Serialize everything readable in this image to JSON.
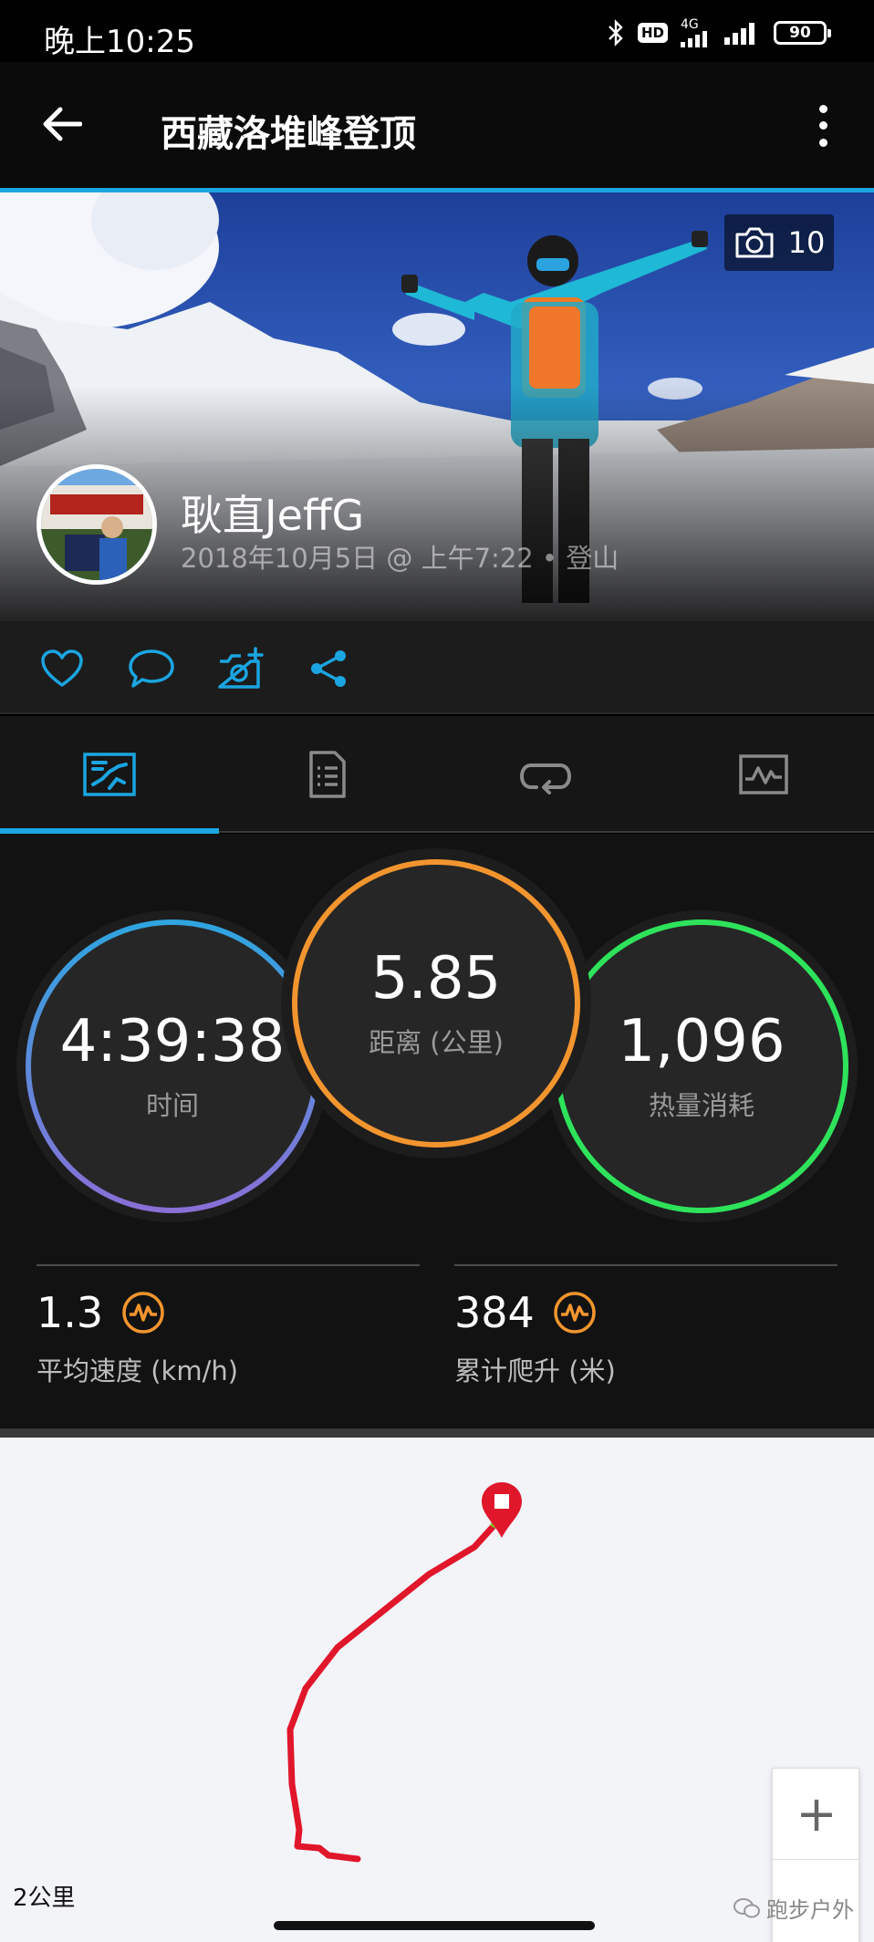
{
  "status_bar": {
    "time": "晚上10:25",
    "hd": "HD",
    "network": "4G",
    "battery": "90",
    "icons": [
      "bluetooth-icon",
      "hd-voice-icon",
      "signal-4g-icon",
      "signal-icon",
      "battery-icon"
    ]
  },
  "header": {
    "title": "西藏洛堆峰登顶",
    "back_icon": "arrow-left-icon",
    "menu_icon": "more-vertical-icon"
  },
  "hero": {
    "photo_count": "10",
    "photo_icon": "camera-icon",
    "user_name": "耿直JeffG",
    "activity_meta": "2018年10月5日 @ 上午7:22 • 登山"
  },
  "actions": [
    "like-icon",
    "comment-icon",
    "add-photo-icon",
    "share-icon"
  ],
  "tabs": [
    "overview-tab-icon",
    "details-tab-icon",
    "laps-tab-icon",
    "charts-tab-icon"
  ],
  "stats": {
    "time": {
      "value": "4:39:38",
      "label": "时间"
    },
    "distance": {
      "value": "5.85",
      "label": "距离 (公里)"
    },
    "calories": {
      "value": "1,096",
      "label": "热量消耗"
    },
    "avg_speed": {
      "value": "1.3",
      "label": "平均速度 (km/h)"
    },
    "ascent": {
      "value": "384",
      "label": "累计爬升 (米)"
    }
  },
  "map": {
    "zoom_in_label": "+",
    "scale": "2公里",
    "watermark": "跑步户外",
    "route_color": "#e0162b"
  },
  "colors": {
    "accent": "#1ba5e1",
    "distance_ring": "#f2952f",
    "calories_ring": "#2ee35b",
    "time_ring_top": "#2fa5df",
    "time_ring_bottom": "#8a6fd6"
  }
}
